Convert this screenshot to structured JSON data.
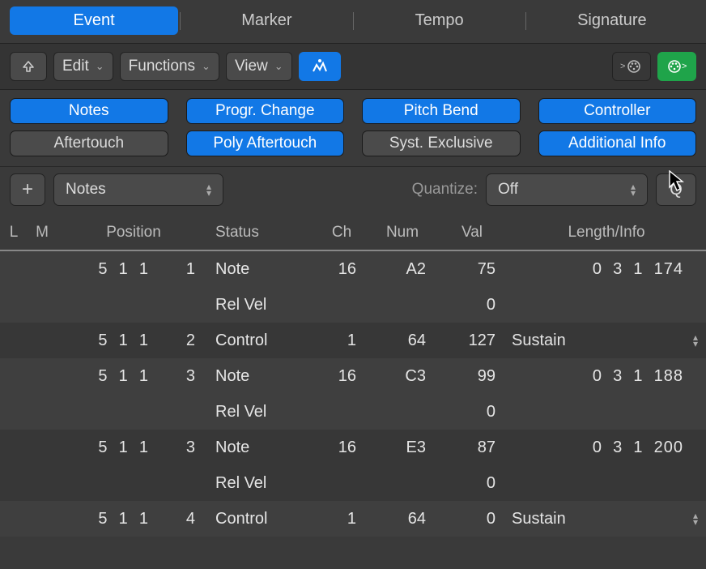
{
  "tabs": {
    "event": "Event",
    "marker": "Marker",
    "tempo": "Tempo",
    "signature": "Signature"
  },
  "toolbar": {
    "edit": "Edit",
    "functions": "Functions",
    "view": "View"
  },
  "filters": {
    "notes": "Notes",
    "progr_change": "Progr. Change",
    "pitch_bend": "Pitch Bend",
    "controller": "Controller",
    "aftertouch": "Aftertouch",
    "poly_aftertouch": "Poly Aftertouch",
    "syst_exclusive": "Syst. Exclusive",
    "additional_info": "Additional Info"
  },
  "addrow": {
    "type": "Notes",
    "quantize_label": "Quantize:",
    "quantize_value": "Off",
    "q_button": "Q"
  },
  "headers": {
    "L": "L",
    "M": "M",
    "Position": "Position",
    "Status": "Status",
    "Ch": "Ch",
    "Num": "Num",
    "Val": "Val",
    "Length": "Length/Info"
  },
  "rows": [
    {
      "pos": "5  1  1       1",
      "status": "Note",
      "ch": "16",
      "num": "A2",
      "val": "75",
      "len": "0  3  1  174"
    },
    {
      "pos": "",
      "status": "Rel Vel",
      "ch": "",
      "num": "",
      "val": "0",
      "len": ""
    },
    {
      "pos": "5  1  1       2",
      "status": "Control",
      "ch": "1",
      "num": "64",
      "val": "127",
      "len": "Sustain",
      "textual": true
    },
    {
      "pos": "5  1  1       3",
      "status": "Note",
      "ch": "16",
      "num": "C3",
      "val": "99",
      "len": "0  3  1  188"
    },
    {
      "pos": "",
      "status": "Rel Vel",
      "ch": "",
      "num": "",
      "val": "0",
      "len": ""
    },
    {
      "pos": "5  1  1       3",
      "status": "Note",
      "ch": "16",
      "num": "E3",
      "val": "87",
      "len": "0  3  1  200"
    },
    {
      "pos": "",
      "status": "Rel Vel",
      "ch": "",
      "num": "",
      "val": "0",
      "len": ""
    },
    {
      "pos": "5  1  1       4",
      "status": "Control",
      "ch": "1",
      "num": "64",
      "val": "0",
      "len": "Sustain",
      "textual": true
    }
  ]
}
